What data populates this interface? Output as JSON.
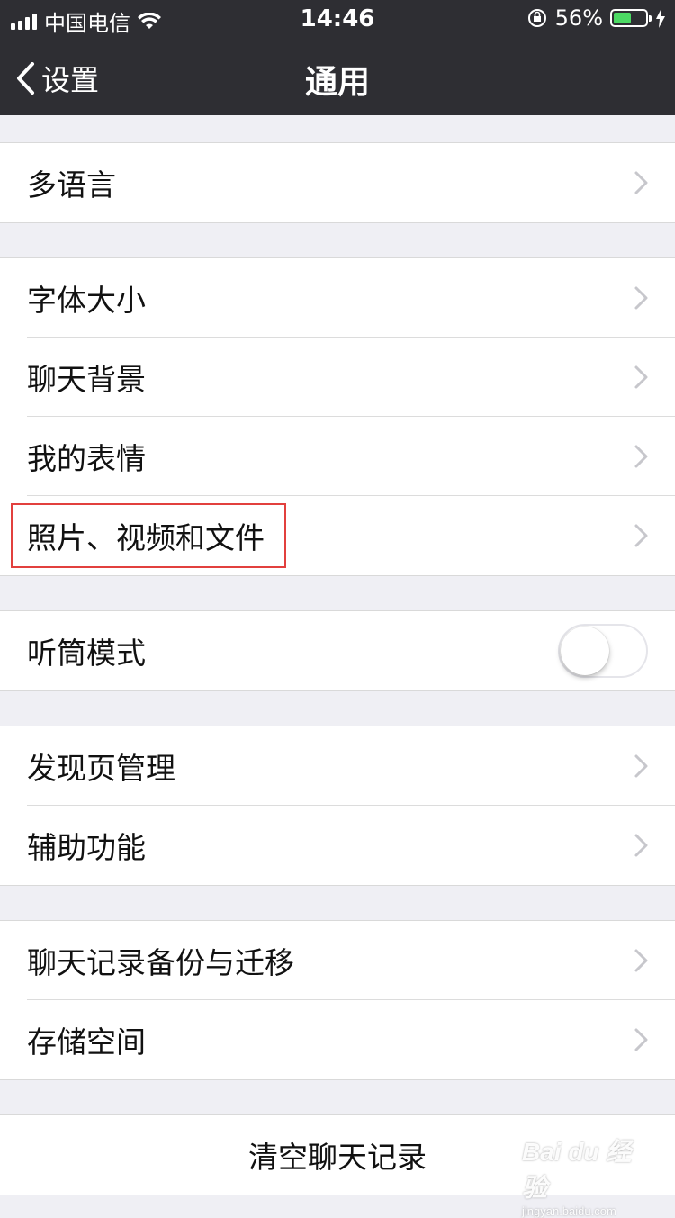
{
  "status_bar": {
    "carrier": "中国电信",
    "time": "14:46",
    "battery": "56%",
    "battery_level": 0.56
  },
  "nav": {
    "back_label": "设置",
    "title": "通用"
  },
  "groups": {
    "g1": [
      "多语言"
    ],
    "g2": [
      "字体大小",
      "聊天背景",
      "我的表情",
      "照片、视频和文件"
    ],
    "g3": [
      "听筒模式"
    ],
    "g4": [
      "发现页管理",
      "辅助功能"
    ],
    "g5": [
      "聊天记录备份与迁移",
      "存储空间"
    ],
    "g6": [
      "清空聊天记录"
    ]
  },
  "toggle_earpiece_on": false,
  "watermark": {
    "brand": "Bai du 经验",
    "url": "jingyan.baidu.com"
  },
  "colors": {
    "nav_bg": "#2e2e33",
    "page_bg": "#efeff4",
    "highlight": "#e2403e",
    "battery_fill": "#4cd964"
  }
}
